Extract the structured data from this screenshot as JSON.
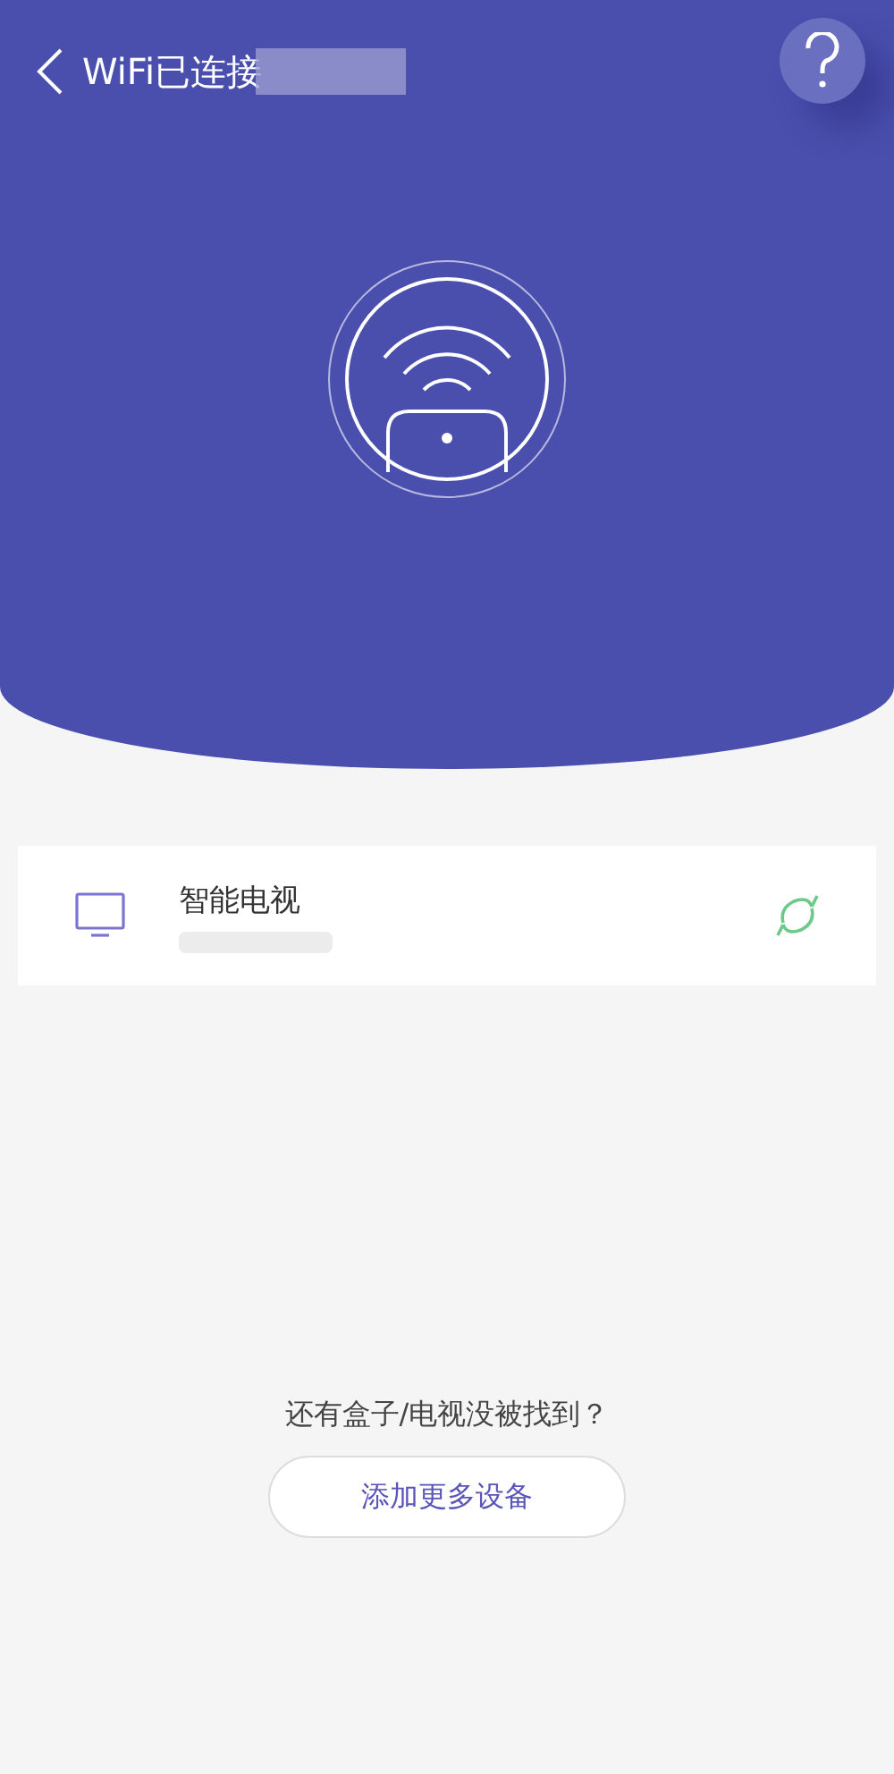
{
  "header": {
    "title": "WiFi已连接"
  },
  "devices": [
    {
      "name": "智能电视"
    }
  ],
  "footer": {
    "hint": "还有盒子/电视没被找到？",
    "button": "添加更多设备"
  }
}
